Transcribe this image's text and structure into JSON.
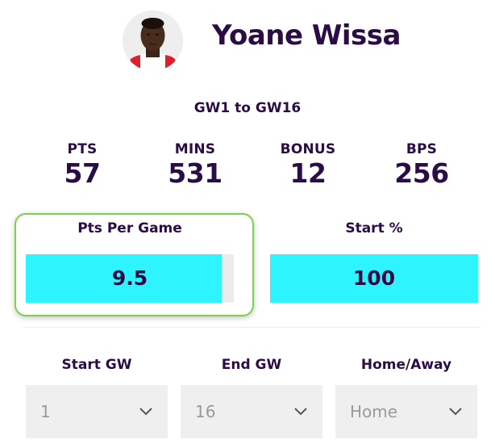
{
  "player": {
    "name": "Yoane Wissa"
  },
  "range_label": "GW1 to GW16",
  "stats": [
    {
      "label": "PTS",
      "value": "57"
    },
    {
      "label": "MINS",
      "value": "531"
    },
    {
      "label": "BONUS",
      "value": "12"
    },
    {
      "label": "BPS",
      "value": "256"
    }
  ],
  "metrics": [
    {
      "label": "Pts Per Game",
      "value": "9.5",
      "fill_fraction": 0.94,
      "highlighted": true
    },
    {
      "label": "Start %",
      "value": "100",
      "fill_fraction": 1.0,
      "highlighted": false
    }
  ],
  "filters": [
    {
      "label": "Start GW",
      "value": "1"
    },
    {
      "label": "End GW",
      "value": "16"
    },
    {
      "label": "Home/Away",
      "value": "Home"
    }
  ],
  "colors": {
    "text": "#2b0d45",
    "bar_fill": "#2ef4ff",
    "highlight_border": "#7bd24a",
    "select_bg": "#efefef"
  },
  "icons": {
    "avatar": "player-photo",
    "dropdown": "chevron-down-icon"
  }
}
